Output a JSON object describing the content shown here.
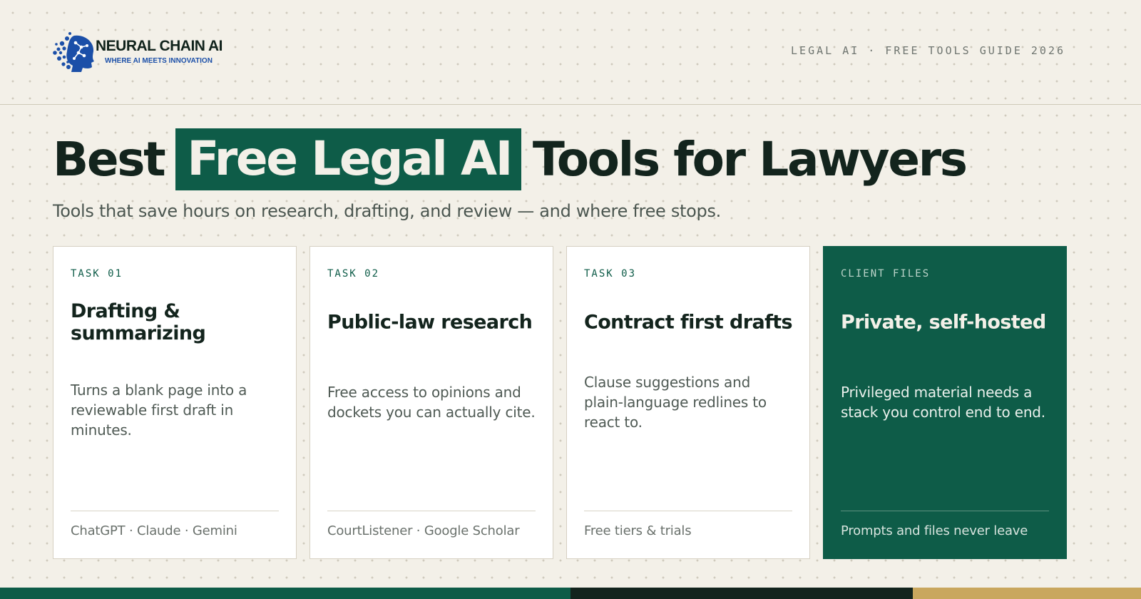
{
  "brand": {
    "name": "NEURAL CHAIN AI",
    "tagline": "WHERE AI MEETS INNOVATION",
    "logo_icon": "brain-network-icon"
  },
  "header": {
    "label": "LEGAL AI · FREE TOOLS GUIDE 2026"
  },
  "hero": {
    "title_before": "Best",
    "title_highlight": "Free Legal AI",
    "title_after": "Tools for Lawyers",
    "subtitle": "Tools that save hours on research, drafting, and review — and where free stops."
  },
  "cards": [
    {
      "tag": "TASK 01",
      "title": "Drafting & summarizing",
      "body": "Turns a blank page into a reviewable first draft in minutes.",
      "footer": "ChatGPT · Claude · Gemini"
    },
    {
      "tag": "TASK 02",
      "title": "Public-law research",
      "body": "Free access to opinions and dockets you can actually cite.",
      "footer": "CourtListener · Google Scholar"
    },
    {
      "tag": "TASK 03",
      "title": "Contract first drafts",
      "body": "Clause suggestions and plain-language redlines to react to.",
      "footer": "Free tiers & trials"
    },
    {
      "tag": "CLIENT FILES",
      "title": "Private, self-hosted",
      "body": "Privileged material needs a stack you control end to end.",
      "footer": "Prompts and files never leave"
    }
  ],
  "colors": {
    "background": "#f3f0e8",
    "accent_green": "#0e5c48",
    "ink": "#13241d",
    "brand_blue": "#1b4fa8",
    "gold": "#c9a75e"
  },
  "bottom_bar": {
    "segments": [
      {
        "color": "#0e5c48",
        "share": 0.5
      },
      {
        "color": "#13241d",
        "share": 0.3
      },
      {
        "color": "#c9a75e",
        "share": 0.2
      }
    ]
  }
}
